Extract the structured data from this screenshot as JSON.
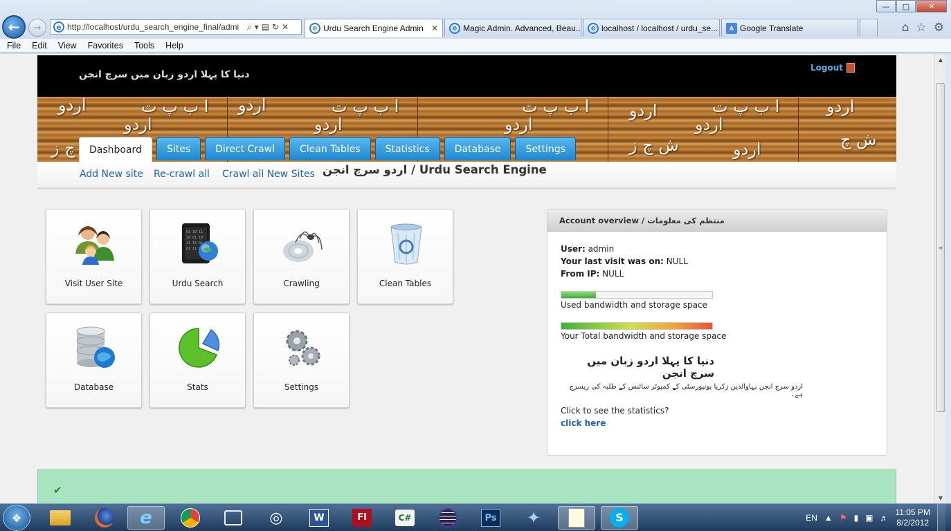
{
  "browser": {
    "address": "http://localhost/urdu_search_engine_final/admi",
    "tabs": [
      {
        "label": "Urdu Search Engine Admin",
        "active": true
      },
      {
        "label": "Magic Admin. Advanced, Beau...",
        "active": false
      },
      {
        "label": "localhost / localhost / urdu_se...",
        "active": false
      },
      {
        "label": "Google Translate",
        "active": false
      }
    ],
    "menu": [
      "File",
      "Edit",
      "View",
      "Favorites",
      "Tools",
      "Help"
    ],
    "icons": {
      "back": "back-arrow-icon",
      "forward": "forward-arrow-icon",
      "home": "home-icon",
      "favorites": "star-icon",
      "tools": "gear-icon"
    }
  },
  "site": {
    "header_title": "دنیا کا پہلا اردو زبان میں سرچ انجن",
    "logout_label": "Logout",
    "nav_tabs": [
      "Dashboard",
      "Sites",
      "Direct Crawl",
      "Clean Tables",
      "Statistics",
      "Database",
      "Settings"
    ],
    "active_tab": "Dashboard",
    "sub_links": [
      "Add New site",
      "Re-crawl all",
      "Crawl all New Sites"
    ],
    "breadcrumb": "اردو سرچ انجن / Urdu Search Engine"
  },
  "dashboard": {
    "tiles": [
      {
        "label": "Visit User Site",
        "icon": "users-icon"
      },
      {
        "label": "Urdu Search",
        "icon": "search-terminal-icon"
      },
      {
        "label": "Crawling",
        "icon": "spider-cd-icon"
      },
      {
        "label": "Clean Tables",
        "icon": "recycle-bin-icon"
      },
      {
        "label": "Database",
        "icon": "database-globe-icon"
      },
      {
        "label": "Stats",
        "icon": "pie-chart-icon"
      },
      {
        "label": "Settings",
        "icon": "gears-icon"
      }
    ]
  },
  "account": {
    "title": "Account overview / منتظم کی معلومات",
    "user_label": "User:",
    "user_value": "admin",
    "last_visit_label": "Your last visit was on:",
    "last_visit_value": "NULL",
    "ip_label": "From IP:",
    "ip_value": "NULL",
    "used_bar_label": "Used bandwidth and storage space",
    "used_bar_fraction": 0.23,
    "total_bar_label": "Your Total bandwidth and storage space",
    "total_bar_fraction": 1.0,
    "urdu_heading": "دنیا کا پہلا اردو زبان میں سرچ انجن",
    "urdu_text": "اردو سرچ انجن بہاوالدین زکریا یونیورسٹی کے کمپوٹر سائنس کے طلبہ کی ریسرچ ہے۔",
    "stats_prompt": "Click to see the statistics?",
    "stats_link": "click here"
  },
  "colors": {
    "tab_blue": "#2a8fd6",
    "link_blue": "#1a63b0",
    "success_bg": "#a9e4c0"
  },
  "taskbar": {
    "apps": [
      "explorer-icon",
      "firefox-icon",
      "ie-icon",
      "chrome-icon",
      "media-icon",
      "wifi-icon",
      "word-icon",
      "flash-icon",
      "csharp-icon",
      "eclipse-icon",
      "photoshop-icon",
      "tool-icon",
      "notepad-icon",
      "skype-icon"
    ],
    "lang": "EN",
    "time": "11:05 PM",
    "date": "8/2/2012"
  }
}
